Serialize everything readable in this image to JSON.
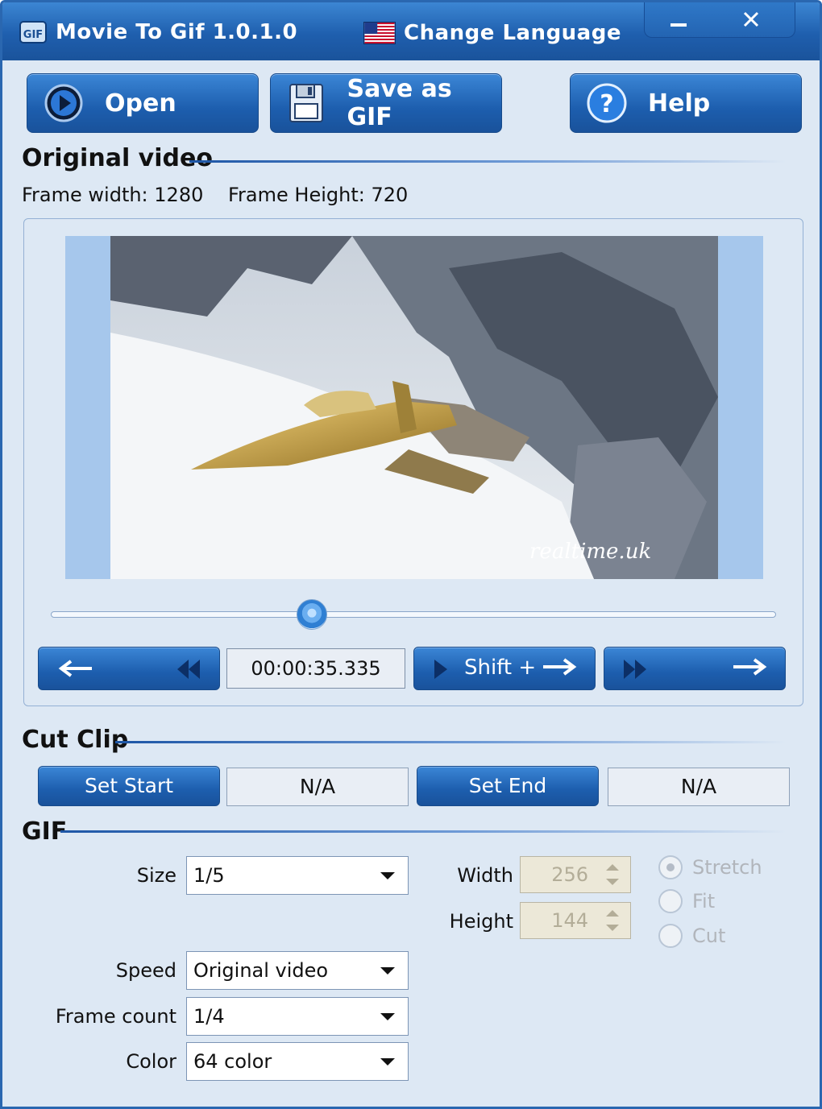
{
  "window": {
    "title": "Movie To Gif 1.0.1.0",
    "app_icon": "gif-app-icon",
    "language_label": "Change Language",
    "flag_icon": "us-flag-icon",
    "minimize_icon": "minimize-icon",
    "close_icon": "close-icon"
  },
  "toolbar": {
    "open_label": "Open",
    "open_icon": "play-circle-icon",
    "save_label": "Save as GIF",
    "save_icon": "floppy-disk-icon",
    "help_label": "Help",
    "help_icon": "question-mark-icon"
  },
  "original": {
    "section_title": "Original video",
    "frame_width_text": "Frame width: 1280",
    "frame_height_text": "Frame Height: 720",
    "watermark": "realtime.uk",
    "position_fraction": 0.36,
    "time": "00:00:35.335",
    "shift_label": "Shift +"
  },
  "cut_clip": {
    "section_title": "Cut Clip",
    "set_start_label": "Set Start",
    "start_value": "N/A",
    "set_end_label": "Set End",
    "end_value": "N/A"
  },
  "gif": {
    "section_title": "GIF",
    "size_label": "Size",
    "size_value": "1/5",
    "width_label": "Width",
    "width_value": "256",
    "height_label": "Height",
    "height_value": "144",
    "speed_label": "Speed",
    "speed_value": "Original video",
    "frame_count_label": "Frame count",
    "frame_count_value": "1/4",
    "color_label": "Color",
    "color_value": "64 color",
    "mode_options": [
      "Stretch",
      "Fit",
      "Cut"
    ],
    "mode_selected": "Stretch"
  },
  "colors": {
    "accent": "#1d5eae",
    "window_bg": "#dde8f4",
    "disabled_text": "#b1b5bb"
  }
}
